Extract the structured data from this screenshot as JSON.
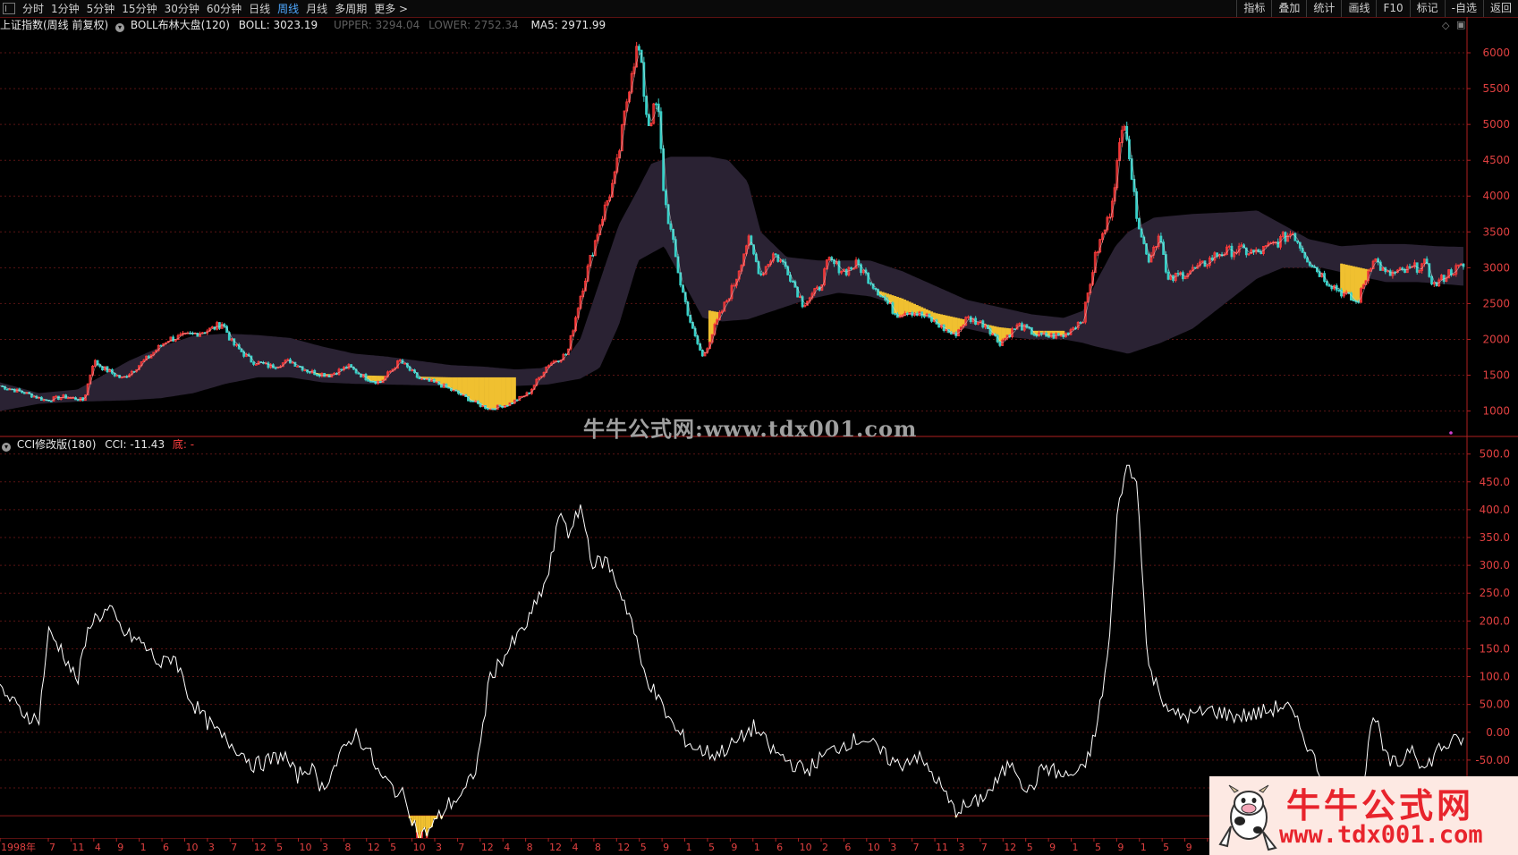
{
  "toolbar": {
    "periods": [
      "分时",
      "1分钟",
      "5分钟",
      "15分钟",
      "30分钟",
      "60分钟",
      "日线",
      "周线",
      "月线",
      "多周期",
      "更多 >"
    ],
    "active_period": "周线",
    "right_buttons": [
      "指标",
      "叠加",
      "统计",
      "画线",
      "F10",
      "标记",
      "-自选",
      "返回"
    ]
  },
  "main_chart": {
    "title": "上证指数(周线 前复权)",
    "indicator": "BOLL布林大盘(120)",
    "boll_label": "BOLL: 3023.19",
    "upper_label": "UPPER: 3294.04",
    "lower_label": "LOWER: 2752.34",
    "ma5_label": "MA5: 2971.99",
    "y_ticks": [
      "6000",
      "5500",
      "5000",
      "4500",
      "4000",
      "3500",
      "3000",
      "2500",
      "2000",
      "1500",
      "1000"
    ]
  },
  "sub_chart": {
    "indicator": "CCI修改版(180)",
    "cci_label": "CCI: -11.43",
    "signal_label": "底: -",
    "y_ticks": [
      "500.0",
      "450.0",
      "400.0",
      "350.0",
      "300.0",
      "250.0",
      "200.0",
      "150.0",
      "100.0",
      "50.00",
      "0.00",
      "-50.00",
      "-100.0"
    ]
  },
  "x_axis": {
    "labels": [
      "1998年",
      "7",
      "11",
      "4",
      "9",
      "1",
      "6",
      "10",
      "3",
      "7",
      "12",
      "5",
      "10",
      "3",
      "8",
      "12",
      "5",
      "10",
      "3",
      "7",
      "12",
      "4",
      "8",
      "12",
      "4",
      "8",
      "12",
      "5",
      "9",
      "1",
      "5",
      "9",
      "1",
      "6",
      "10",
      "2",
      "6",
      "10",
      "3",
      "7",
      "11",
      "3",
      "7",
      "12",
      "5",
      "9",
      "1",
      "5",
      "9",
      "1",
      "5",
      "9",
      "1"
    ]
  },
  "watermark": {
    "center_text": "牛牛公式网:www.tdx001.com",
    "logo_title": "牛牛公式网",
    "logo_url": "www.tdx001.com"
  },
  "chart_data": [
    {
      "type": "line",
      "title": "上证指数(周线 前复权)",
      "series": [
        {
          "name": "BOLL",
          "x": [
            "1998",
            "1999",
            "2000",
            "2001",
            "2002",
            "2003",
            "2004",
            "2005",
            "2006",
            "2007",
            "2008",
            "2009",
            "2010",
            "2011",
            "2012",
            "2013",
            "2014",
            "2015",
            "2016",
            "2017",
            "2018",
            "2019",
            "2020"
          ],
          "values": [
            1300,
            1400,
            1800,
            2000,
            1750,
            1550,
            1500,
            1300,
            1500,
            3800,
            3500,
            2800,
            2900,
            2700,
            2300,
            2150,
            2100,
            2800,
            3000,
            3200,
            3100,
            3000,
            3020
          ]
        },
        {
          "name": "UPPER",
          "values": [
            1400,
            1700,
            2050,
            2100,
            1950,
            1750,
            1650,
            1500,
            2000,
            4600,
            4500,
            3050,
            3050,
            2950,
            2550,
            2300,
            2350,
            3800,
            3300,
            3300,
            3250,
            3250,
            3290
          ]
        },
        {
          "name": "LOWER",
          "values": [
            1000,
            1200,
            1400,
            1900,
            1550,
            1400,
            1350,
            1150,
            1000,
            2100,
            2250,
            2300,
            2350,
            2400,
            2000,
            1950,
            1900,
            1800,
            2700,
            2900,
            2950,
            2800,
            2750
          ]
        },
        {
          "name": "MA5",
          "values": [
            1200,
            1500,
            2000,
            2200,
            1600,
            1500,
            1400,
            1100,
            1700,
            5800,
            2000,
            3300,
            3000,
            2700,
            2200,
            2100,
            2300,
            4800,
            2900,
            3300,
            2600,
            3000,
            2970
          ]
        }
      ],
      "ylim": [
        1000,
        6000
      ]
    },
    {
      "type": "line",
      "title": "CCI修改版(180)",
      "series": [
        {
          "name": "CCI",
          "x": [
            "1998",
            "1999",
            "2000",
            "2001",
            "2002",
            "2003",
            "2004",
            "2005",
            "2006",
            "2007",
            "2008",
            "2009",
            "2010",
            "2011",
            "2012",
            "2013",
            "2014",
            "2015",
            "2016",
            "2017",
            "2018",
            "2019",
            "2020"
          ],
          "values": [
            50,
            180,
            230,
            110,
            -30,
            -80,
            0,
            -150,
            150,
            400,
            80,
            -30,
            0,
            -60,
            -50,
            -150,
            -60,
            490,
            70,
            50,
            -130,
            50,
            -11.43
          ]
        }
      ],
      "ylim": [
        -130,
        520
      ]
    }
  ]
}
